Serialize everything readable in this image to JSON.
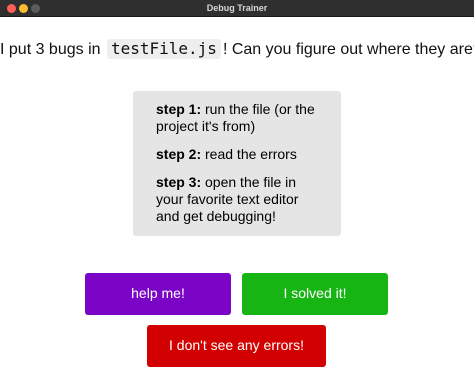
{
  "window": {
    "title": "Debug Trainer"
  },
  "headline": {
    "prefix": "I put 3 bugs in ",
    "filename": "testFile.js",
    "suffix": "! Can you figure out where they are?"
  },
  "steps": [
    {
      "label": "step 1:",
      "text": " run the file (or the project it's from)"
    },
    {
      "label": "step 2:",
      "text": " read the errors"
    },
    {
      "label": "step 3:",
      "text": " open the file in your favorite text editor and get debugging!"
    }
  ],
  "buttons": {
    "help_label": "help me!",
    "solved_label": "I solved it!",
    "no_errors_label": "I don't see any errors!"
  },
  "colors": {
    "titlebar": "#2f2f2f",
    "help_button": "#7b05c6",
    "solved_button": "#16b514",
    "no_errors_button": "#d20000",
    "steps_panel": "#e5e5e5"
  }
}
